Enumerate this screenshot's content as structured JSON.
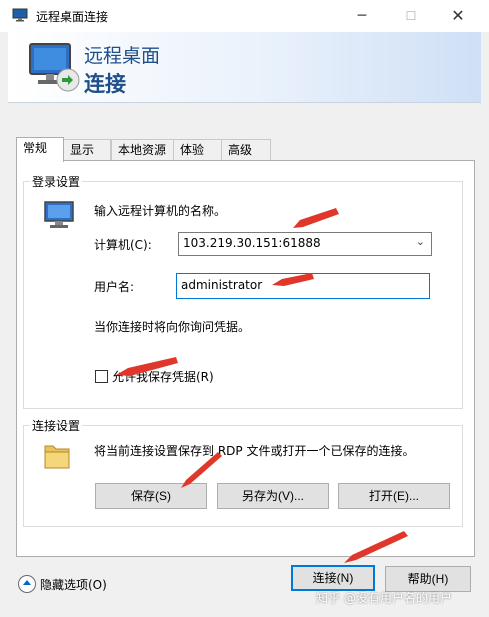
{
  "window": {
    "title": "远程桌面连接",
    "min_glyph": "─",
    "max_glyph": "☐",
    "close_glyph": "✕"
  },
  "banner": {
    "line1": "远程桌面",
    "line2": "连接"
  },
  "tabs": [
    {
      "label": "常规",
      "active": true
    },
    {
      "label": "显示",
      "active": false
    },
    {
      "label": "本地资源",
      "active": false
    },
    {
      "label": "体验",
      "active": false
    },
    {
      "label": "高级",
      "active": false
    }
  ],
  "login_settings": {
    "legend": "登录设置",
    "instruction": "输入远程计算机的名称。",
    "computer_label": "计算机(C):",
    "computer_value": "103.219.30.151:61888",
    "username_label": "用户名:",
    "username_value": "administrator",
    "credential_note": "当你连接时将向你询问凭据。",
    "save_credentials_label": "允许我保存凭据(R)",
    "save_credentials_checked": false
  },
  "connection_settings": {
    "legend": "连接设置",
    "description": "将当前连接设置保存到 RDP 文件或打开一个已保存的连接。",
    "save_button": "保存(S)",
    "save_as_button": "另存为(V)...",
    "open_button": "打开(E)..."
  },
  "footer": {
    "hide_options": "隐藏选项(O)",
    "connect_button": "连接(N)",
    "help_button": "帮助(H)"
  },
  "watermark": "知乎 @没有用户名的用户",
  "colors": {
    "accent": "#0078d7",
    "banner_text": "#1f4f8b",
    "annotation_arrow": "#e0372b"
  },
  "icons": {
    "app": "remote-desktop-icon",
    "computer": "monitor-icon",
    "folder": "folder-icon"
  }
}
